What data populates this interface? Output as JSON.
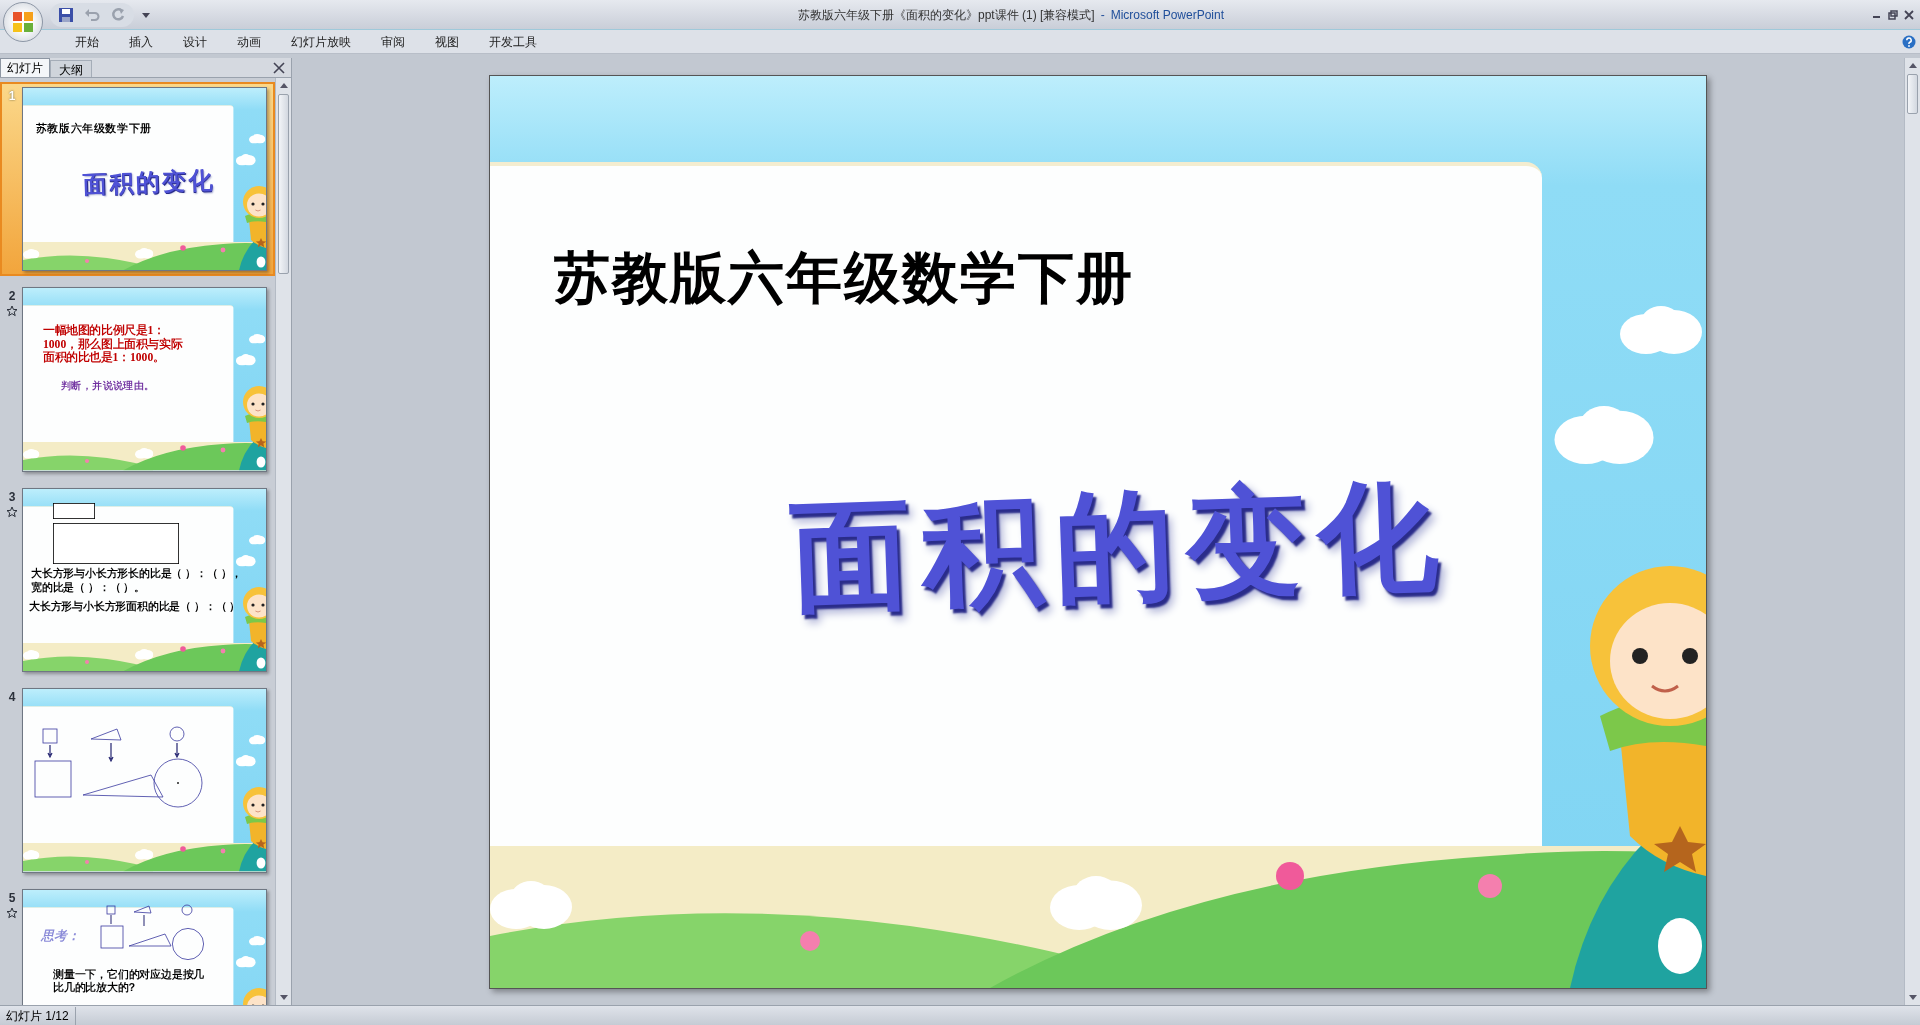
{
  "window": {
    "title": "苏教版六年级下册《面积的变化》ppt课件 (1) [兼容模式]",
    "separator": "-",
    "app": "Microsoft PowerPoint"
  },
  "ribbon_tabs": [
    "开始",
    "插入",
    "设计",
    "动画",
    "幻灯片放映",
    "审阅",
    "视图",
    "开发工具"
  ],
  "panel_tabs": [
    {
      "label": "幻灯片",
      "selected": true
    },
    {
      "label": "大纲",
      "selected": false
    }
  ],
  "thumbnails": [
    {
      "number": "1",
      "selected": true,
      "has_animation": false,
      "kind": "title",
      "subtitle": "苏教版六年级数学下册",
      "title": "面积的变化"
    },
    {
      "number": "2",
      "selected": false,
      "has_animation": true,
      "kind": "text",
      "lines": [
        "一幅地图的比例尺是1：1000，那么图上面积与实际面积的比也是1：1000。"
      ],
      "prompt": "判断，并说说理由。"
    },
    {
      "number": "3",
      "selected": false,
      "has_animation": true,
      "kind": "rectangles",
      "lines": [
        "大长方形与小长方形长的比是（ ）：（ ），",
        "宽的比是（ ）：（ ）。"
      ],
      "prompt": "大长方形与小长方形面积的比是（ ）：（ ）"
    },
    {
      "number": "4",
      "selected": false,
      "has_animation": false,
      "kind": "shapes"
    },
    {
      "number": "5",
      "selected": false,
      "has_animation": true,
      "kind": "think",
      "heading": "思考：",
      "lines": [
        "测量一下，它们的对应边是按几比几的比放大的?"
      ]
    }
  ],
  "slide": {
    "kind": "title",
    "subtitle": "苏教版六年级数学下册",
    "title": "面积的变化"
  },
  "status_bar": {
    "slide_count": "幻灯片 1/12"
  }
}
